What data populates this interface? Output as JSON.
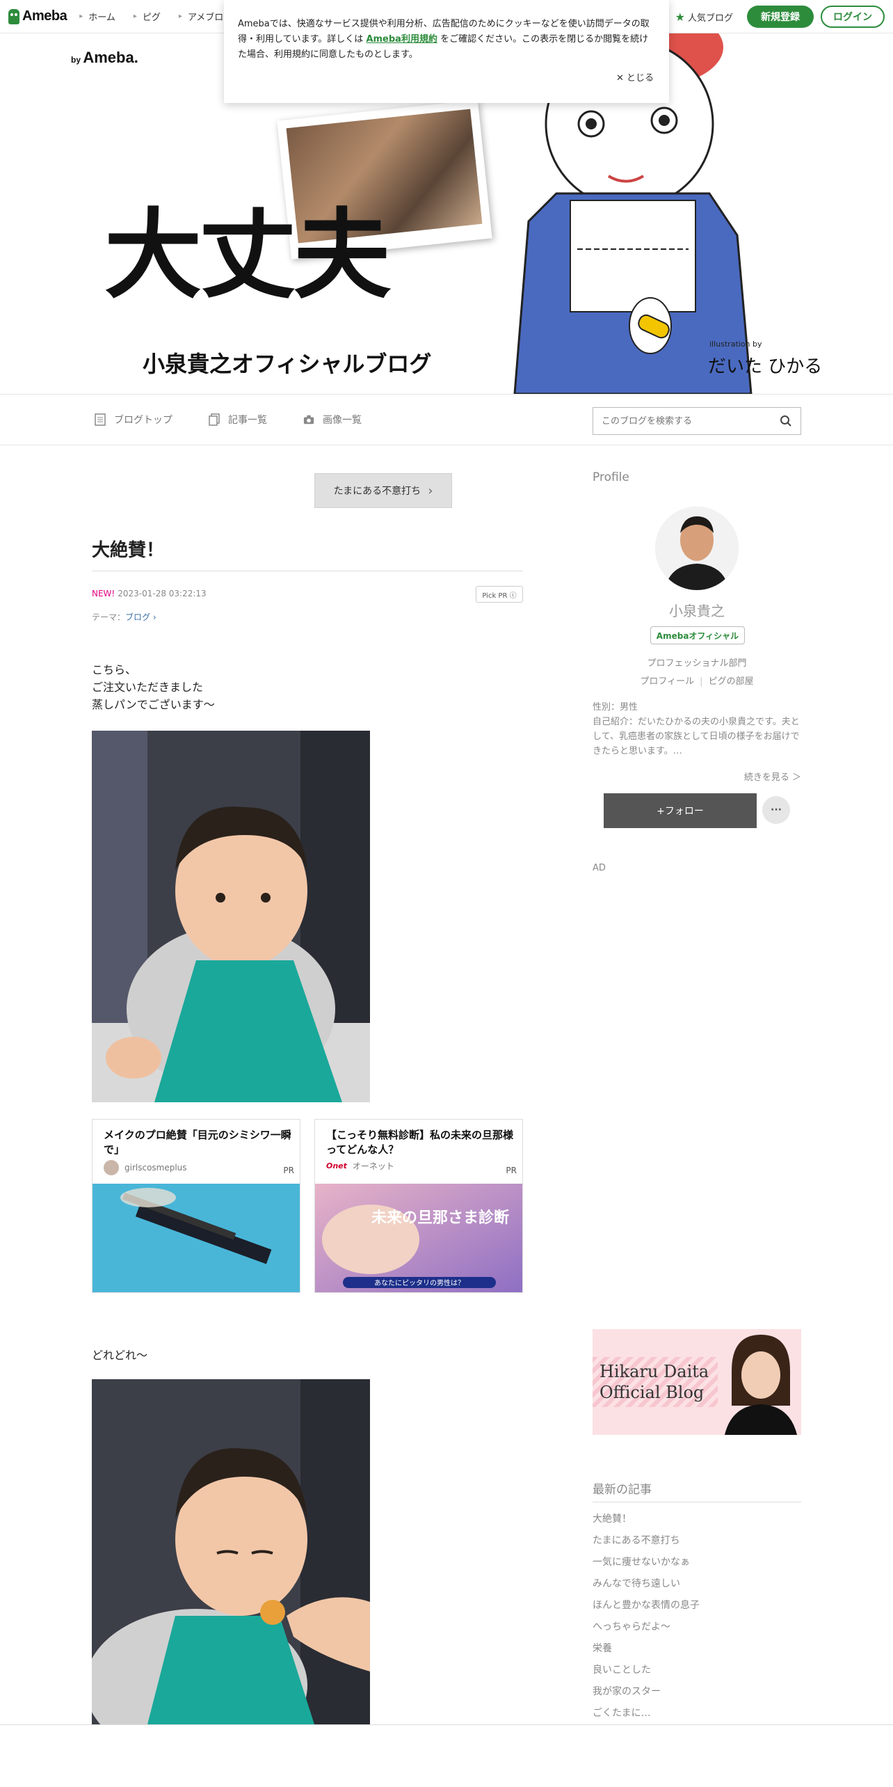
{
  "topbar": {
    "logo": "Ameba",
    "nav": [
      "ホーム",
      "ピグ",
      "アメブロ"
    ],
    "popular": "人気ブログ",
    "register": "新規登録",
    "login": "ログイン"
  },
  "cookie": {
    "text_before": "Amebaでは、快適なサービス提供や利用分析、広告配信のためにクッキーなどを使い訪問データの取得・利用しています。詳しくは",
    "link": "Ameba利用規約",
    "text_after": "をご確認ください。この表示を閉じるか閲覧を続けた場合、利用規約に同意したものとします。",
    "close": "とじる"
  },
  "banner": {
    "by": "by",
    "by_brand": "Ameba.",
    "title": "大丈夫",
    "subtitle": "小泉貴之オフィシャルブログ",
    "illustration_by": "illustration by",
    "illustrator": "だいた ひかる"
  },
  "subnav": {
    "items": [
      "ブログトップ",
      "記事一覧",
      "画像一覧"
    ],
    "search_placeholder": "このブログを検索する"
  },
  "post": {
    "prev": "たまにある不意打ち",
    "title": "大絶賛！",
    "new_badge": "NEW!",
    "datetime": "2023-01-28 03:22:13",
    "pick_pr": "Pick PR ⓘ",
    "theme_label": "テーマ：",
    "theme": "ブログ",
    "lines": [
      "こちら、",
      "ご注文いただきました",
      "蒸しパンでございます〜"
    ],
    "line2": "どれどれ〜"
  },
  "ads": [
    {
      "title": "メイクのプロ絶賛「目元のシミシワ一瞬で」",
      "source": "girlscosmeplus",
      "pr": "PR"
    },
    {
      "title": "【こっそり無料診断】私の未来の旦那様ってどんな人？",
      "source": "オーネット",
      "pr": "PR",
      "img_title": "未来の旦那さま診断",
      "img_sub": "あなたにピッタリの男性は？"
    }
  ],
  "profile": {
    "heading": "Profile",
    "name": "小泉貴之",
    "badge": "Amebaオフィシャル",
    "category": "プロフェッショナル部門",
    "link1": "プロフィール",
    "link2": "ピグの部屋",
    "gender": "性別：男性",
    "intro": "自己紹介：だいたひかるの夫の小泉貴之です。夫として、乳癌患者の家族として日頃の様子をお届けできたらと思います。…",
    "more": "続きを見る ＞",
    "follow": "+フォロー",
    "dots": "···",
    "ad": "AD"
  },
  "hikaru_banner": {
    "line1": "Hikaru Daita",
    "line2": "Official Blog"
  },
  "latest": {
    "heading": "最新の記事",
    "items": [
      "大絶賛！",
      "たまにある不意打ち",
      "一気に痩せないかなぁ",
      "みんなで待ち遠しい",
      "ほんと豊かな表情の息子",
      "へっちゃらだよ〜",
      "栄養",
      "良いことした",
      "我が家のスター",
      "ごくたまに…"
    ]
  },
  "colors": {
    "brand": "#2d8c3c",
    "new": "#e4007f",
    "follow": "#555555"
  }
}
